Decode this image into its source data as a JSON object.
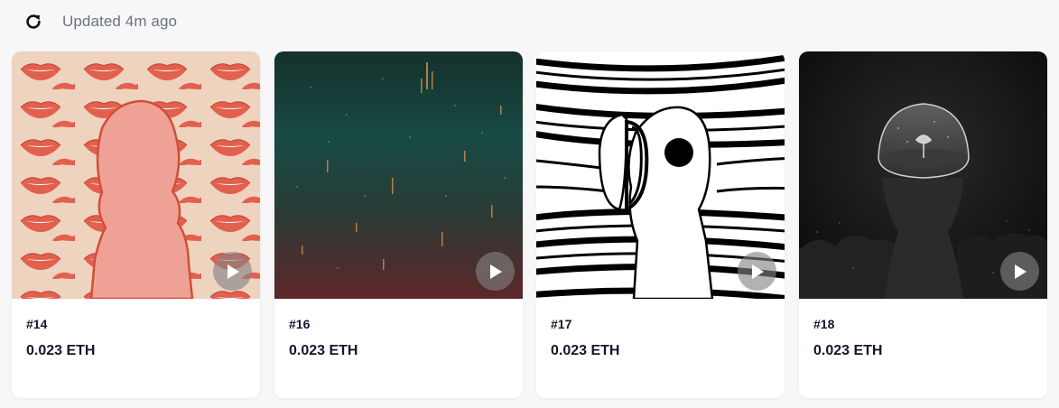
{
  "header": {
    "refresh_icon": "refresh-icon",
    "updated_label": "Updated 4m ago"
  },
  "cards": [
    {
      "token_id": "#14",
      "price": "0.023 ETH",
      "artwork": "pink-lips-silhouette",
      "has_video": true
    },
    {
      "token_id": "#16",
      "price": "0.023 ETH",
      "artwork": "teal-red-gradient-sparks",
      "has_video": true
    },
    {
      "token_id": "#17",
      "price": "0.023 ETH",
      "artwork": "bw-astronaut-speed-lines",
      "has_video": true
    },
    {
      "token_id": "#18",
      "price": "0.023 ETH",
      "artwork": "glass-dome-head-tree",
      "has_video": true
    }
  ],
  "colors": {
    "page_bg": "#f7f7f7",
    "card_bg": "#ffffff",
    "text_primary": "#111827",
    "text_muted": "#6b7280",
    "play_overlay": "#828282"
  }
}
